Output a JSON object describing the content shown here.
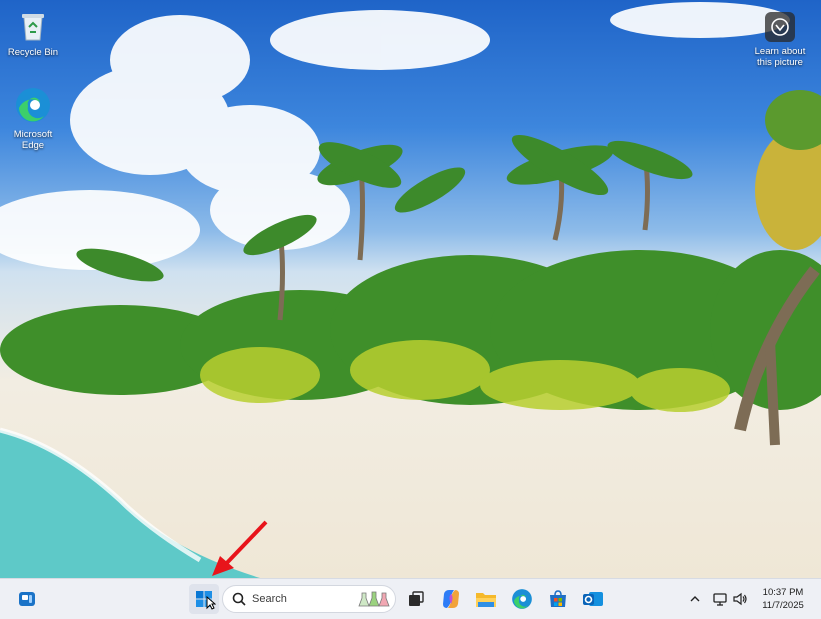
{
  "desktop": {
    "icons": [
      {
        "label": "Recycle Bin",
        "icon": "recycle-bin-icon"
      },
      {
        "label": "Microsoft Edge",
        "icon": "edge-icon"
      }
    ],
    "spotlight": {
      "label": "Learn about this picture",
      "icon": "camera-icon"
    }
  },
  "taskbar": {
    "search": {
      "placeholder": "Search",
      "icon": "search-icon"
    },
    "apps": [
      {
        "name": "widgets",
        "icon": "widgets-icon"
      },
      {
        "name": "start",
        "icon": "windows-logo-icon"
      },
      {
        "name": "task-view",
        "icon": "task-view-icon"
      },
      {
        "name": "copilot",
        "icon": "copilot-icon"
      },
      {
        "name": "file-explorer",
        "icon": "folder-icon"
      },
      {
        "name": "edge",
        "icon": "edge-icon"
      },
      {
        "name": "microsoft-store",
        "icon": "store-icon"
      },
      {
        "name": "outlook",
        "icon": "outlook-icon"
      }
    ],
    "tray": {
      "chevron": "chevron-up-icon",
      "network": "network-icon",
      "volume": "volume-icon",
      "time": "10:37 PM",
      "date": "11/7/2025"
    }
  },
  "colors": {
    "accent": "#0067c0",
    "annotation_arrow": "#e8141b",
    "taskbar_bg": "#eef0f5"
  }
}
